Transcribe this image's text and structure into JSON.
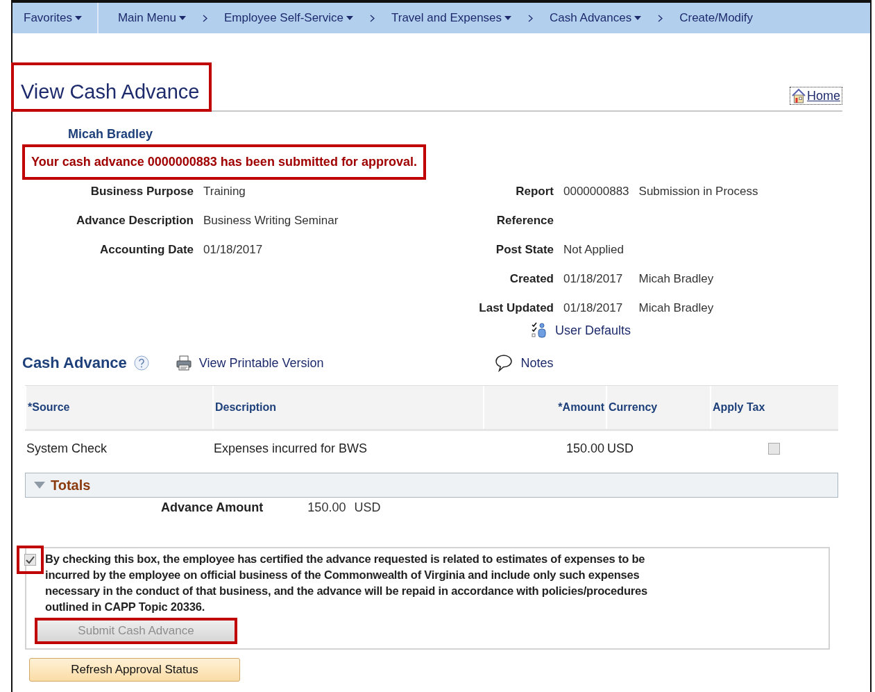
{
  "nav": {
    "items": [
      {
        "label": "Favorites",
        "kind": "menu",
        "dropdown": true
      },
      {
        "label": "Main Menu",
        "kind": "menu",
        "dropdown": true
      },
      {
        "label": "Employee Self-Service",
        "kind": "crumb",
        "dropdown": true
      },
      {
        "label": "Travel and Expenses",
        "kind": "crumb",
        "dropdown": true
      },
      {
        "label": "Cash Advances",
        "kind": "crumb",
        "dropdown": true
      },
      {
        "label": "Create/Modify",
        "kind": "crumb",
        "dropdown": false
      }
    ]
  },
  "page": {
    "title": "View Cash Advance",
    "title_highlighted": true,
    "home_link": "Home"
  },
  "employee": "Micah Bradley",
  "message": {
    "text": "Your cash advance 0000000883 has been submitted for approval.",
    "highlighted": true
  },
  "left_fields": [
    {
      "label": "Business Purpose",
      "values": [
        "Training"
      ]
    },
    {
      "label": "Advance Description",
      "values": [
        "Business Writing Seminar"
      ]
    },
    {
      "label": "Accounting Date",
      "values": [
        "01/18/2017"
      ]
    }
  ],
  "right_fields": [
    {
      "label": "Report",
      "values": [
        "0000000883",
        "Submission in Process"
      ]
    },
    {
      "label": "Reference"
    },
    {
      "label": "Post State",
      "values": [
        "Not Applied"
      ]
    },
    {
      "label": "Created",
      "values": [
        "01/18/2017",
        "Micah Bradley"
      ]
    },
    {
      "label": "Last Updated",
      "values": [
        "01/18/2017",
        "Micah Bradley"
      ]
    }
  ],
  "user_defaults": "User Defaults",
  "section": {
    "title": "Cash Advance",
    "printable_link": "View Printable Version",
    "notes_link": "Notes"
  },
  "table": {
    "columns": [
      "*Source",
      "Description",
      "*Amount",
      "Currency",
      "Apply Tax"
    ],
    "rows": [
      {
        "source": "System Check",
        "description": "Expenses incurred for BWS",
        "amount": "150.00",
        "currency": "USD",
        "apply_tax": false
      }
    ]
  },
  "totals": {
    "title": "Totals",
    "expanded": true,
    "label": "Advance Amount",
    "amount": "150.00",
    "currency": "USD"
  },
  "certification": {
    "text": "By checking this box, the employee has certified the advance requested is related to estimates of expenses to be incurred by the employee on official business of the Commonwealth of Virginia and include only such expenses necessary in the conduct of that business, and the advance will be repaid in accordance with policies/procedures outlined in CAPP Topic 20336.",
    "checked": true,
    "highlighted": true
  },
  "submit": {
    "label": "Submit Cash Advance",
    "disabled": true,
    "highlighted": true
  },
  "refresh": {
    "label": "Refresh Approval Status"
  }
}
